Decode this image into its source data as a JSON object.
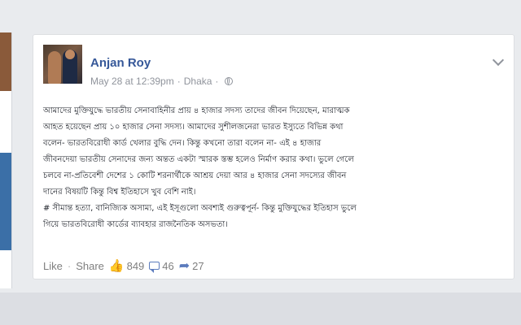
{
  "post": {
    "author": "Anjan Roy",
    "date": "May 28 at 12:39pm",
    "separator": "·",
    "location": "Dhaka",
    "paragraph1_lines": [
      "আমাদের মুক্তিযুদ্ধে ভারতীয় সেনাবাহিনীর প্রায় ৪ হাজার সদস্য তাদের জীবন দিয়েছেন, মারাত্মক",
      "আহত হয়েছেন প্রায় ১০ হাজার সেনা সদস্য। আমাদের সুশীলজনেরা ভারত ইস্যুতে বিভিন্ন কথা",
      "বলেন- ভারতবিরোধী কার্ড খেলার বুদ্ধি দেন। কিন্তু কখনো তারা বলেন না- এই ৪ হাজার",
      "জীবনদেয়া ভারতীয় সেনাদের জন্য অন্তত একটা স্মারক স্তম্ভ হলেও নির্মাণ করার কথা। ভুলে গেলে",
      "চলবে না-প্রতিবেশী দেশের ১ কোটি শরনার্থীকে আশ্রয় দেয়া আর ৪ হাজার সেনা সদস্যের জীবন",
      "দানের বিষয়টি কিন্তু বিশ্ব ইতিহাসে খুব বেশি নাই।"
    ],
    "paragraph2_lines": [
      "# সীমান্ত হত্যা, বানিজ্যিক অসাম্য, এই ইসূগুলো অবশ্যই গুরুত্বপূর্ন- কিন্তু মুক্তিযুদ্ধের ইতিহাস ভুলে",
      "গিয়ে ভারতবিরোধী কার্ডের ব্যাবহার রাজনৈতিক অসভতা।"
    ]
  },
  "actions": {
    "like_label": "Like",
    "dot": "·",
    "share_label": "Share",
    "likes_count": "849",
    "comments_count": "46",
    "shares_count": "27"
  },
  "colors": {
    "author": "#365899",
    "meta": "#90949c",
    "text": "#1d2129",
    "icon_blue": "#5b7bbd"
  },
  "icons": [
    "globe-icon",
    "chevron-down-icon",
    "thumbs-up-icon",
    "comment-icon",
    "share-icon"
  ]
}
